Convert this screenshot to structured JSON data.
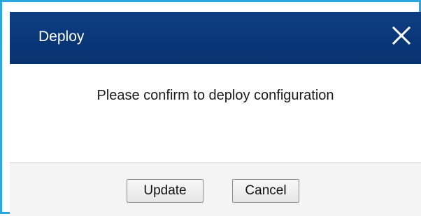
{
  "dialog": {
    "title": "Deploy",
    "close_icon": "close-icon",
    "message": "Please confirm to deploy configuration",
    "buttons": {
      "update_label": "Update",
      "cancel_label": "Cancel"
    }
  },
  "colors": {
    "frame_border": "#29a8e0",
    "titlebar": "#0a3677",
    "title_text": "#ffffff",
    "footer_bg": "#f4f4f4"
  }
}
